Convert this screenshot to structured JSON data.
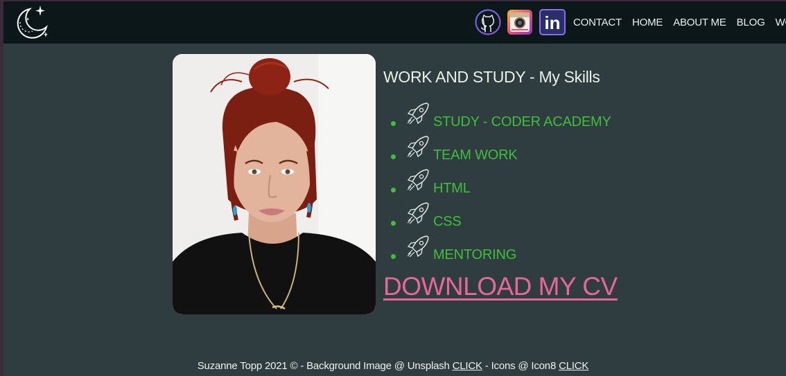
{
  "nav": {
    "logo_icon": "moon-stars-icon",
    "social": [
      {
        "name": "github",
        "icon": "github-icon"
      },
      {
        "name": "instagram",
        "icon": "instagram-icon"
      },
      {
        "name": "linkedin",
        "icon": "linkedin-icon",
        "text": "in"
      }
    ],
    "links": [
      "CONTACT",
      "HOME",
      "ABOUT ME",
      "BLOG",
      "WORK"
    ]
  },
  "main": {
    "photo_alt": "portrait photo",
    "title": "WORK AND STUDY - My Skills",
    "skills": [
      "STUDY - CODER ACADEMY",
      "TEAM WORK",
      "HTML",
      "CSS",
      "MENTORING"
    ],
    "skill_icon": "rocket-icon",
    "download_label": "DOWNLOAD MY CV"
  },
  "footer": {
    "text_before": "Suzanne Topp 2021 © - Background Image @ Unsplash ",
    "link1": "CLICK",
    "text_middle": " - Icons @ Icon8 ",
    "link2": "CLICK"
  },
  "colors": {
    "background": "#2f3c40",
    "navbar": "#0b1719",
    "skill_green": "#3fbf3a",
    "download_pink": "#e8679b"
  }
}
